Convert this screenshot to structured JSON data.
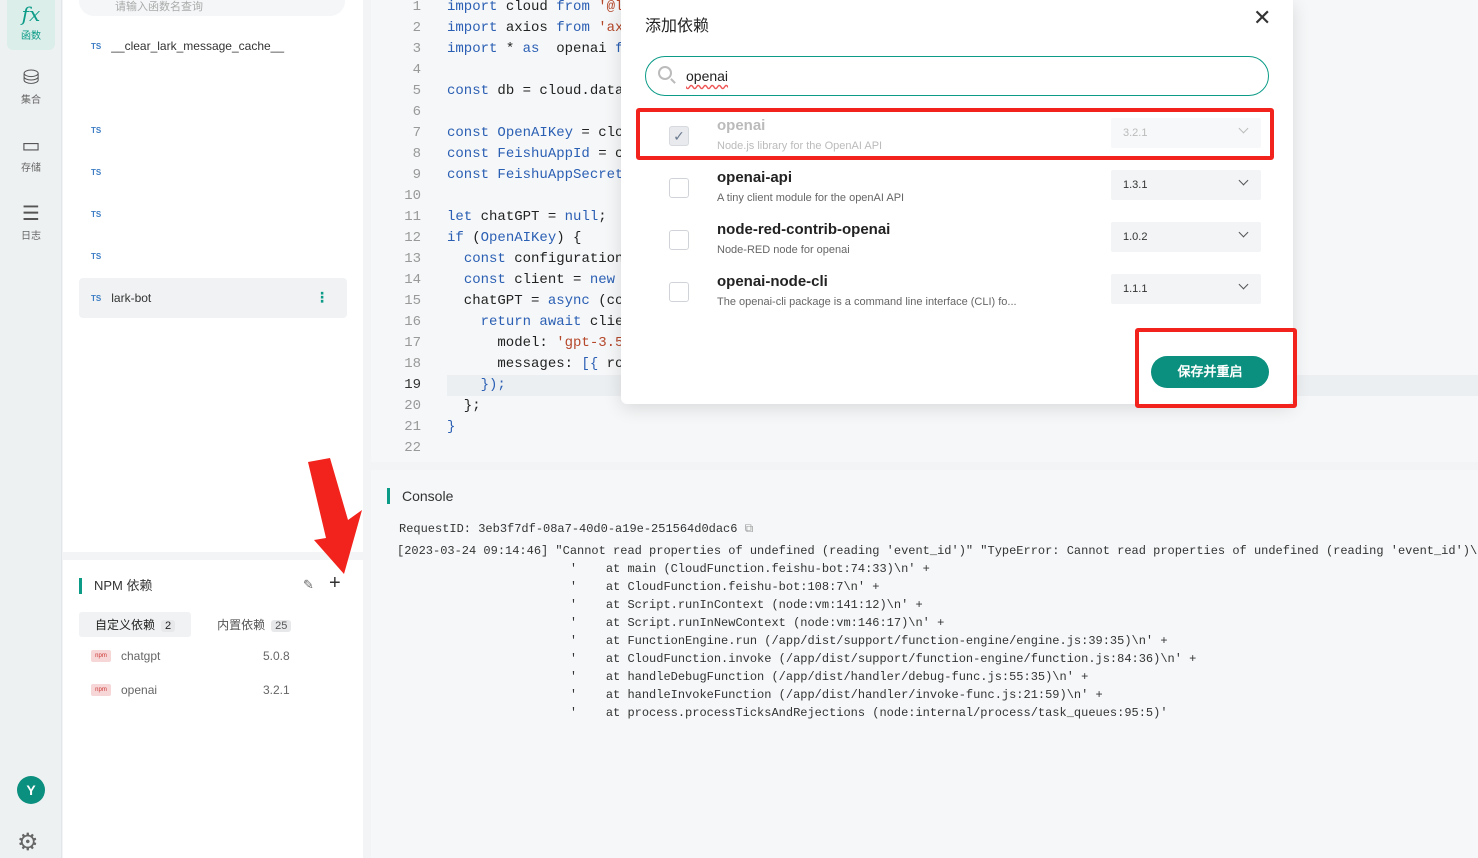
{
  "rail": {
    "items": [
      {
        "icon": "fx",
        "label": "函数"
      },
      {
        "icon": "⛁",
        "label": "集合"
      },
      {
        "icon": "▭",
        "label": "存储"
      },
      {
        "icon": "☰",
        "label": "日志"
      }
    ],
    "avatar_letter": "Y"
  },
  "functions": {
    "search_placeholder": "请输入函数名查询",
    "ts_tag": "TS",
    "items": [
      {
        "name": "__clear_lark_message_cache__"
      },
      {
        "name": ""
      },
      {
        "name": ""
      },
      {
        "name": ""
      },
      {
        "name": ""
      },
      {
        "name": "lark-bot"
      }
    ]
  },
  "npm": {
    "title": "NPM 依赖",
    "tabs": [
      {
        "label": "自定义依赖",
        "count": "2"
      },
      {
        "label": "内置依赖",
        "count": "25"
      }
    ],
    "packages": [
      {
        "name": "chatgpt",
        "version": "5.0.8"
      },
      {
        "name": "openai",
        "version": "3.2.1"
      }
    ]
  },
  "editor": {
    "current_line": "19",
    "lines": [
      {
        "n": "1",
        "tokens": [
          {
            "k": "kw",
            "t": "import"
          },
          {
            "k": "txt",
            "t": " cloud "
          },
          {
            "k": "kw",
            "t": "from"
          },
          {
            "k": "str",
            "t": " '@l"
          }
        ]
      },
      {
        "n": "2",
        "tokens": [
          {
            "k": "kw",
            "t": "import"
          },
          {
            "k": "txt",
            "t": " axios "
          },
          {
            "k": "kw",
            "t": "from"
          },
          {
            "k": "str",
            "t": " 'ax"
          }
        ]
      },
      {
        "n": "3",
        "tokens": [
          {
            "k": "kw",
            "t": "import"
          },
          {
            "k": "txt",
            "t": " * "
          },
          {
            "k": "kw",
            "t": "as"
          },
          {
            "k": "txt",
            "t": "  openai "
          },
          {
            "k": "kw",
            "t": "f"
          }
        ]
      },
      {
        "n": "4",
        "tokens": []
      },
      {
        "n": "5",
        "tokens": [
          {
            "k": "kw",
            "t": "const"
          },
          {
            "k": "txt",
            "t": " db = cloud.data"
          }
        ]
      },
      {
        "n": "6",
        "tokens": []
      },
      {
        "n": "7",
        "tokens": [
          {
            "k": "kw",
            "t": "const"
          },
          {
            "k": "kw",
            "t": " OpenAIKey"
          },
          {
            "k": "txt",
            "t": " = clo"
          }
        ]
      },
      {
        "n": "8",
        "tokens": [
          {
            "k": "kw",
            "t": "const"
          },
          {
            "k": "kw",
            "t": " FeishuAppId"
          },
          {
            "k": "txt",
            "t": " = c"
          }
        ]
      },
      {
        "n": "9",
        "tokens": [
          {
            "k": "kw",
            "t": "const"
          },
          {
            "k": "kw",
            "t": " FeishuAppSecret"
          }
        ]
      },
      {
        "n": "10",
        "tokens": []
      },
      {
        "n": "11",
        "tokens": [
          {
            "k": "kw",
            "t": "let"
          },
          {
            "k": "txt",
            "t": " chatGPT = "
          },
          {
            "k": "kw",
            "t": "null"
          },
          {
            "k": "txt",
            "t": ";"
          }
        ]
      },
      {
        "n": "12",
        "tokens": [
          {
            "k": "kw",
            "t": "if"
          },
          {
            "k": "txt",
            "t": " ("
          },
          {
            "k": "kw",
            "t": "OpenAIKey"
          },
          {
            "k": "txt",
            "t": ") {"
          }
        ]
      },
      {
        "n": "13",
        "tokens": [
          {
            "k": "txt",
            "t": "  "
          },
          {
            "k": "kw",
            "t": "const"
          },
          {
            "k": "txt",
            "t": " configuration"
          }
        ]
      },
      {
        "n": "14",
        "tokens": [
          {
            "k": "txt",
            "t": "  "
          },
          {
            "k": "kw",
            "t": "const"
          },
          {
            "k": "txt",
            "t": " client = "
          },
          {
            "k": "kw",
            "t": "new"
          }
        ]
      },
      {
        "n": "15",
        "tokens": [
          {
            "k": "txt",
            "t": "  chatGPT = "
          },
          {
            "k": "kw",
            "t": "async"
          },
          {
            "k": "txt",
            "t": " (co"
          }
        ]
      },
      {
        "n": "16",
        "tokens": [
          {
            "k": "txt",
            "t": "    "
          },
          {
            "k": "kw",
            "t": "return await"
          },
          {
            "k": "txt",
            "t": " clie"
          }
        ]
      },
      {
        "n": "17",
        "tokens": [
          {
            "k": "txt",
            "t": "      model: "
          },
          {
            "k": "str",
            "t": "'gpt-3.5"
          }
        ]
      },
      {
        "n": "18",
        "tokens": [
          {
            "k": "txt",
            "t": "      messages: "
          },
          {
            "k": "kw",
            "t": "[{"
          },
          {
            "k": "txt",
            "t": " ro"
          }
        ]
      },
      {
        "n": "19",
        "tokens": [
          {
            "k": "txt",
            "t": "    "
          },
          {
            "k": "kw",
            "t": "});"
          }
        ]
      },
      {
        "n": "20",
        "tokens": [
          {
            "k": "txt",
            "t": "  };"
          }
        ]
      },
      {
        "n": "21",
        "tokens": [
          {
            "k": "kw",
            "t": "}"
          }
        ]
      },
      {
        "n": "22",
        "tokens": []
      }
    ]
  },
  "console": {
    "title": "Console",
    "request_id": "RequestID: 3eb3f7df-08a7-40d0-a19e-251564d0dac6",
    "logs": [
      "[2023-03-24 09:14:46] \"Cannot read properties of undefined (reading 'event_id')\" \"TypeError: Cannot read properties of undefined (reading 'event_id')\\",
      "                        '    at main (CloudFunction.feishu-bot:74:33)\\n' +",
      "                        '    at CloudFunction.feishu-bot:108:7\\n' +",
      "                        '    at Script.runInContext (node:vm:141:12)\\n' +",
      "                        '    at Script.runInNewContext (node:vm:146:17)\\n' +",
      "                        '    at FunctionEngine.run (/app/dist/support/function-engine/engine.js:39:35)\\n' +",
      "                        '    at CloudFunction.invoke (/app/dist/support/function-engine/function.js:84:36)\\n' +",
      "                        '    at handleDebugFunction (/app/dist/handler/debug-func.js:55:35)\\n' +",
      "                        '    at handleInvokeFunction (/app/dist/handler/invoke-func.js:21:59)\\n' +",
      "                        '    at process.processTicksAndRejections (node:internal/process/task_queues:95:5)'"
    ]
  },
  "modal": {
    "title": "添加依赖",
    "search_value": "openai",
    "results": [
      {
        "name": "openai",
        "desc": "Node.js library for the OpenAI API",
        "version": "3.2.1",
        "checked": true
      },
      {
        "name": "openai-api",
        "desc": "A tiny client module for the openAI API",
        "version": "1.3.1",
        "checked": false
      },
      {
        "name": "node-red-contrib-openai",
        "desc": "Node-RED node for openai",
        "version": "1.0.2",
        "checked": false
      },
      {
        "name": "openai-node-cli",
        "desc": "The openai-cli package is a command line interface (CLI) fo...",
        "version": "1.1.1",
        "checked": false
      }
    ],
    "save_label": "保存并重启"
  },
  "colors": {
    "accent": "#0b8f7e",
    "highlight": "#f2231c"
  }
}
